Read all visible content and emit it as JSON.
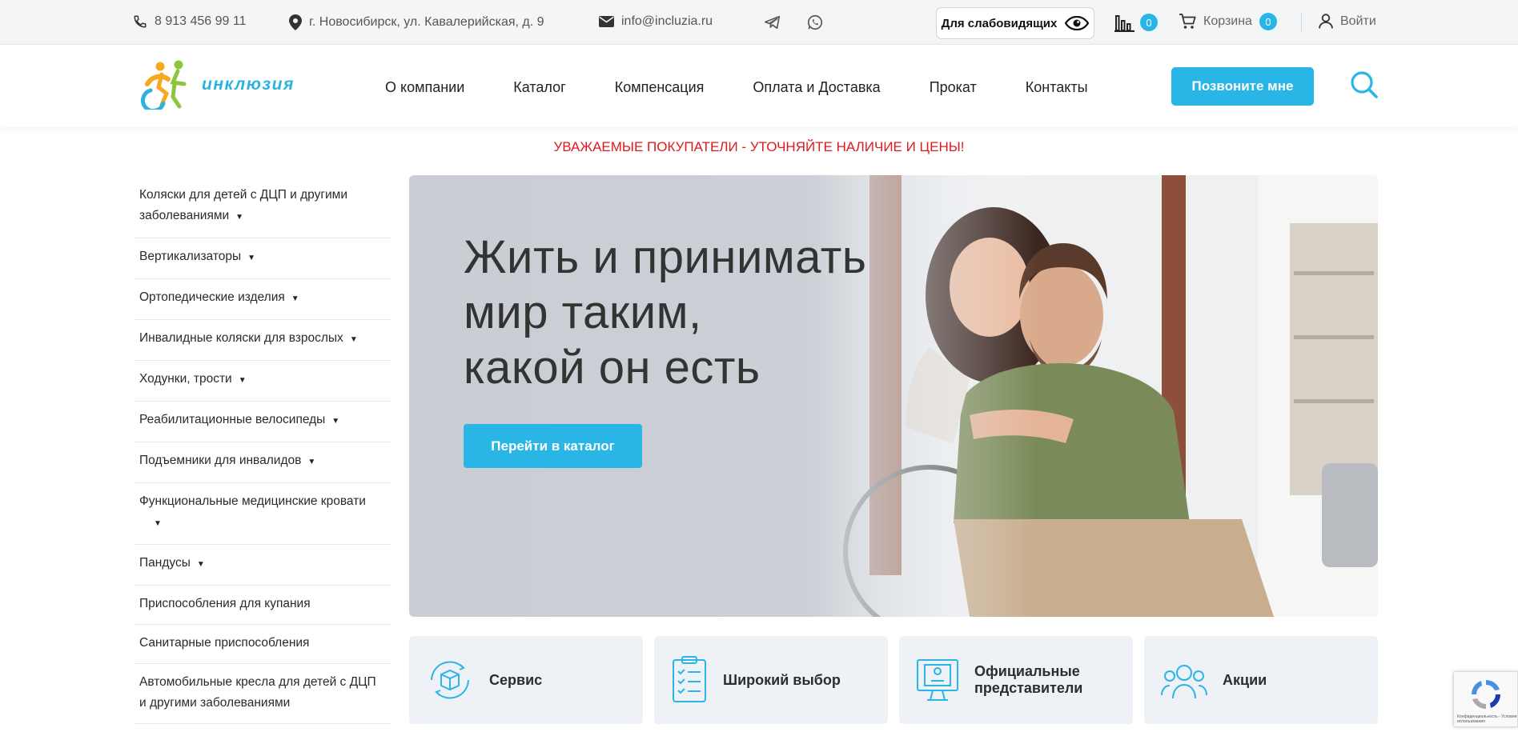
{
  "topbar": {
    "phone": "8 913 456 99 11",
    "address": "г. Новосибирск, ул. Кавалерийская, д. 9",
    "email": "info@incluzia.ru",
    "vision_label": "Для слабовидящих",
    "compare_count": "0",
    "cart_label": "Корзина",
    "cart_count": "0",
    "login_label": "Войти"
  },
  "header": {
    "logo_text": "инклюзия",
    "nav": [
      "О компании",
      "Каталог",
      "Компенсация",
      "Оплата и Доставка",
      "Прокат",
      "Контакты"
    ],
    "call_button": "Позвоните мне"
  },
  "notice": "УВАЖАЕМЫЕ ПОКУПАТЕЛИ - УТОЧНЯЙТЕ НАЛИЧИЕ И ЦЕНЫ!",
  "sidebar": {
    "items": [
      {
        "label": "Коляски для детей с ДЦП и другими заболеваниями",
        "arrow": "▼"
      },
      {
        "label": "Вертикализаторы",
        "arrow": "▼"
      },
      {
        "label": "Ортопедические изделия",
        "arrow": "▼"
      },
      {
        "label": "Инвалидные коляски для взрослых",
        "arrow": "▼"
      },
      {
        "label": "Ходунки, трости",
        "arrow": "▼"
      },
      {
        "label": "Реабилитационные велосипеды",
        "arrow": "▼"
      },
      {
        "label": "Подъемники для инвалидов",
        "arrow": "▼"
      },
      {
        "label": "Функциональные медицинские кровати",
        "arrow": "▼"
      },
      {
        "label": "Пандусы",
        "arrow": "▼"
      },
      {
        "label": "Приспособления для купания",
        "arrow": ""
      },
      {
        "label": "Санитарные приспособления",
        "arrow": ""
      },
      {
        "label": "Автомобильные кресла для детей с ДЦП и другими заболеваниями",
        "arrow": ""
      }
    ]
  },
  "hero": {
    "title_line1": "Жить и принимать",
    "title_line2": "мир таким,",
    "title_line3": "какой он есть",
    "button": "Перейти в каталог"
  },
  "features": [
    {
      "label": "Сервис",
      "icon": "box-cycle-icon"
    },
    {
      "label": "Широкий выбор",
      "icon": "checklist-icon"
    },
    {
      "label": "Официальные представители",
      "icon": "certificate-icon"
    },
    {
      "label": "Акции",
      "icon": "people-group-icon"
    }
  ],
  "recaptcha": {
    "text": "Конфиденциальность - Условия использования"
  },
  "colors": {
    "accent": "#29b6e6",
    "notice": "#e0191d",
    "card_bg": "#eef1f5"
  }
}
